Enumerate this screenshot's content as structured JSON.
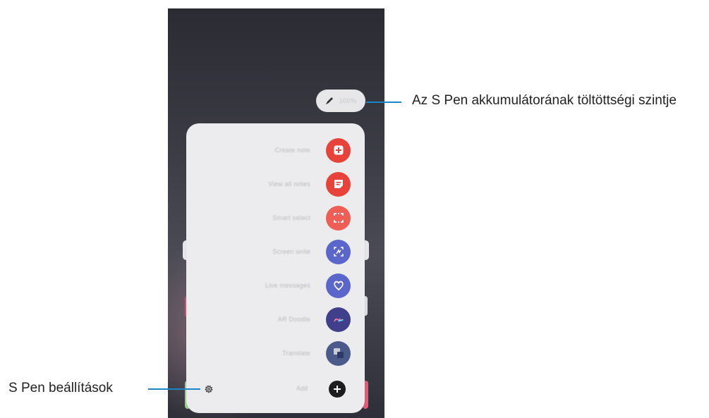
{
  "battery_pill": {
    "icon": "pen-icon",
    "text": "100%"
  },
  "menu_items": [
    {
      "label": "Create note",
      "icon": "create-note-icon",
      "color": "#e8433a"
    },
    {
      "label": "View all notes",
      "icon": "view-notes-icon",
      "color": "#e8433a"
    },
    {
      "label": "Smart select",
      "icon": "smart-select-icon",
      "color": "#ef5e54"
    },
    {
      "label": "Screen write",
      "icon": "screen-write-icon",
      "color": "#5a66c9"
    },
    {
      "label": "Live messages",
      "icon": "live-messages-icon",
      "color": "#5a66c9"
    },
    {
      "label": "AR Doodle",
      "icon": "ar-doodle-icon",
      "color": "#3f3f8c"
    },
    {
      "label": "Translate",
      "icon": "translate-icon",
      "color": "#4a5a8a"
    }
  ],
  "footer": {
    "add_label": "Add",
    "settings_icon": "gear-icon",
    "add_icon": "plus-icon"
  },
  "callouts": {
    "battery": "Az S Pen akkumulátorának töltöttségi szintje",
    "settings": "S Pen beállítások"
  },
  "colors": {
    "accent_line": "#1a86c7",
    "panel": "#ececef"
  }
}
